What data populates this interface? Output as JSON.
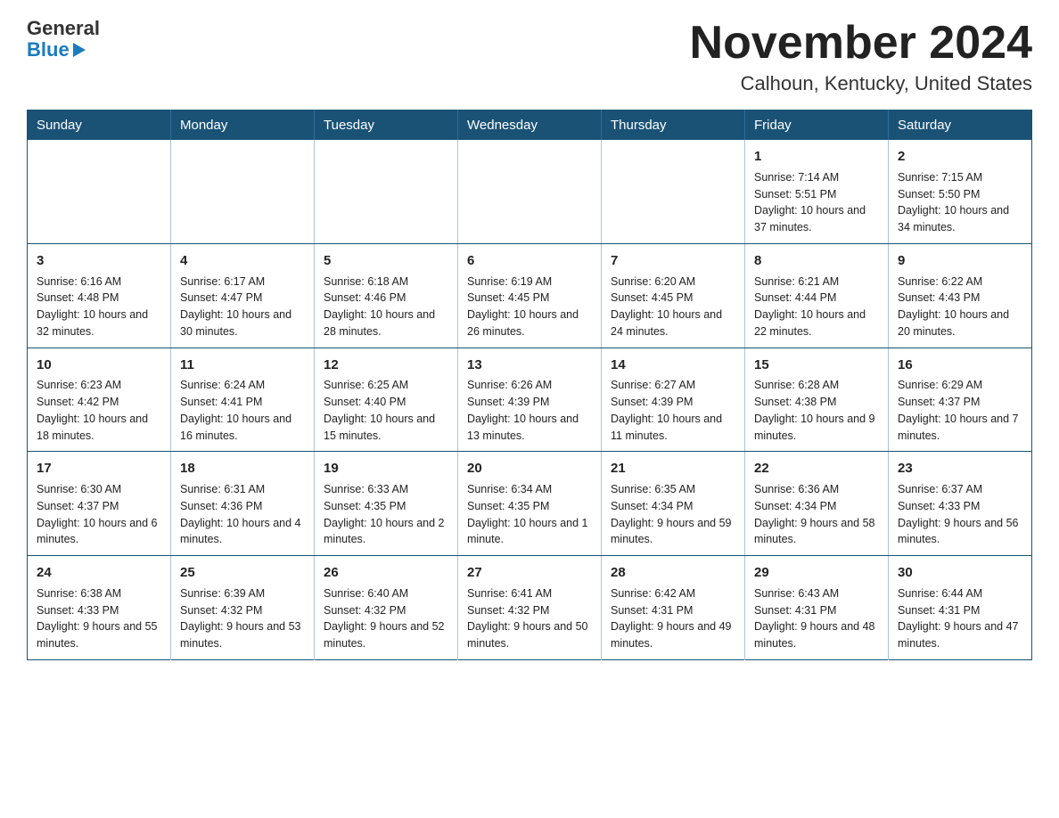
{
  "header": {
    "logo_general": "General",
    "logo_blue": "Blue",
    "title": "November 2024",
    "location": "Calhoun, Kentucky, United States"
  },
  "days_of_week": [
    "Sunday",
    "Monday",
    "Tuesday",
    "Wednesday",
    "Thursday",
    "Friday",
    "Saturday"
  ],
  "weeks": [
    [
      {
        "day": "",
        "info": ""
      },
      {
        "day": "",
        "info": ""
      },
      {
        "day": "",
        "info": ""
      },
      {
        "day": "",
        "info": ""
      },
      {
        "day": "",
        "info": ""
      },
      {
        "day": "1",
        "info": "Sunrise: 7:14 AM\nSunset: 5:51 PM\nDaylight: 10 hours and 37 minutes."
      },
      {
        "day": "2",
        "info": "Sunrise: 7:15 AM\nSunset: 5:50 PM\nDaylight: 10 hours and 34 minutes."
      }
    ],
    [
      {
        "day": "3",
        "info": "Sunrise: 6:16 AM\nSunset: 4:48 PM\nDaylight: 10 hours and 32 minutes."
      },
      {
        "day": "4",
        "info": "Sunrise: 6:17 AM\nSunset: 4:47 PM\nDaylight: 10 hours and 30 minutes."
      },
      {
        "day": "5",
        "info": "Sunrise: 6:18 AM\nSunset: 4:46 PM\nDaylight: 10 hours and 28 minutes."
      },
      {
        "day": "6",
        "info": "Sunrise: 6:19 AM\nSunset: 4:45 PM\nDaylight: 10 hours and 26 minutes."
      },
      {
        "day": "7",
        "info": "Sunrise: 6:20 AM\nSunset: 4:45 PM\nDaylight: 10 hours and 24 minutes."
      },
      {
        "day": "8",
        "info": "Sunrise: 6:21 AM\nSunset: 4:44 PM\nDaylight: 10 hours and 22 minutes."
      },
      {
        "day": "9",
        "info": "Sunrise: 6:22 AM\nSunset: 4:43 PM\nDaylight: 10 hours and 20 minutes."
      }
    ],
    [
      {
        "day": "10",
        "info": "Sunrise: 6:23 AM\nSunset: 4:42 PM\nDaylight: 10 hours and 18 minutes."
      },
      {
        "day": "11",
        "info": "Sunrise: 6:24 AM\nSunset: 4:41 PM\nDaylight: 10 hours and 16 minutes."
      },
      {
        "day": "12",
        "info": "Sunrise: 6:25 AM\nSunset: 4:40 PM\nDaylight: 10 hours and 15 minutes."
      },
      {
        "day": "13",
        "info": "Sunrise: 6:26 AM\nSunset: 4:39 PM\nDaylight: 10 hours and 13 minutes."
      },
      {
        "day": "14",
        "info": "Sunrise: 6:27 AM\nSunset: 4:39 PM\nDaylight: 10 hours and 11 minutes."
      },
      {
        "day": "15",
        "info": "Sunrise: 6:28 AM\nSunset: 4:38 PM\nDaylight: 10 hours and 9 minutes."
      },
      {
        "day": "16",
        "info": "Sunrise: 6:29 AM\nSunset: 4:37 PM\nDaylight: 10 hours and 7 minutes."
      }
    ],
    [
      {
        "day": "17",
        "info": "Sunrise: 6:30 AM\nSunset: 4:37 PM\nDaylight: 10 hours and 6 minutes."
      },
      {
        "day": "18",
        "info": "Sunrise: 6:31 AM\nSunset: 4:36 PM\nDaylight: 10 hours and 4 minutes."
      },
      {
        "day": "19",
        "info": "Sunrise: 6:33 AM\nSunset: 4:35 PM\nDaylight: 10 hours and 2 minutes."
      },
      {
        "day": "20",
        "info": "Sunrise: 6:34 AM\nSunset: 4:35 PM\nDaylight: 10 hours and 1 minute."
      },
      {
        "day": "21",
        "info": "Sunrise: 6:35 AM\nSunset: 4:34 PM\nDaylight: 9 hours and 59 minutes."
      },
      {
        "day": "22",
        "info": "Sunrise: 6:36 AM\nSunset: 4:34 PM\nDaylight: 9 hours and 58 minutes."
      },
      {
        "day": "23",
        "info": "Sunrise: 6:37 AM\nSunset: 4:33 PM\nDaylight: 9 hours and 56 minutes."
      }
    ],
    [
      {
        "day": "24",
        "info": "Sunrise: 6:38 AM\nSunset: 4:33 PM\nDaylight: 9 hours and 55 minutes."
      },
      {
        "day": "25",
        "info": "Sunrise: 6:39 AM\nSunset: 4:32 PM\nDaylight: 9 hours and 53 minutes."
      },
      {
        "day": "26",
        "info": "Sunrise: 6:40 AM\nSunset: 4:32 PM\nDaylight: 9 hours and 52 minutes."
      },
      {
        "day": "27",
        "info": "Sunrise: 6:41 AM\nSunset: 4:32 PM\nDaylight: 9 hours and 50 minutes."
      },
      {
        "day": "28",
        "info": "Sunrise: 6:42 AM\nSunset: 4:31 PM\nDaylight: 9 hours and 49 minutes."
      },
      {
        "day": "29",
        "info": "Sunrise: 6:43 AM\nSunset: 4:31 PM\nDaylight: 9 hours and 48 minutes."
      },
      {
        "day": "30",
        "info": "Sunrise: 6:44 AM\nSunset: 4:31 PM\nDaylight: 9 hours and 47 minutes."
      }
    ]
  ]
}
